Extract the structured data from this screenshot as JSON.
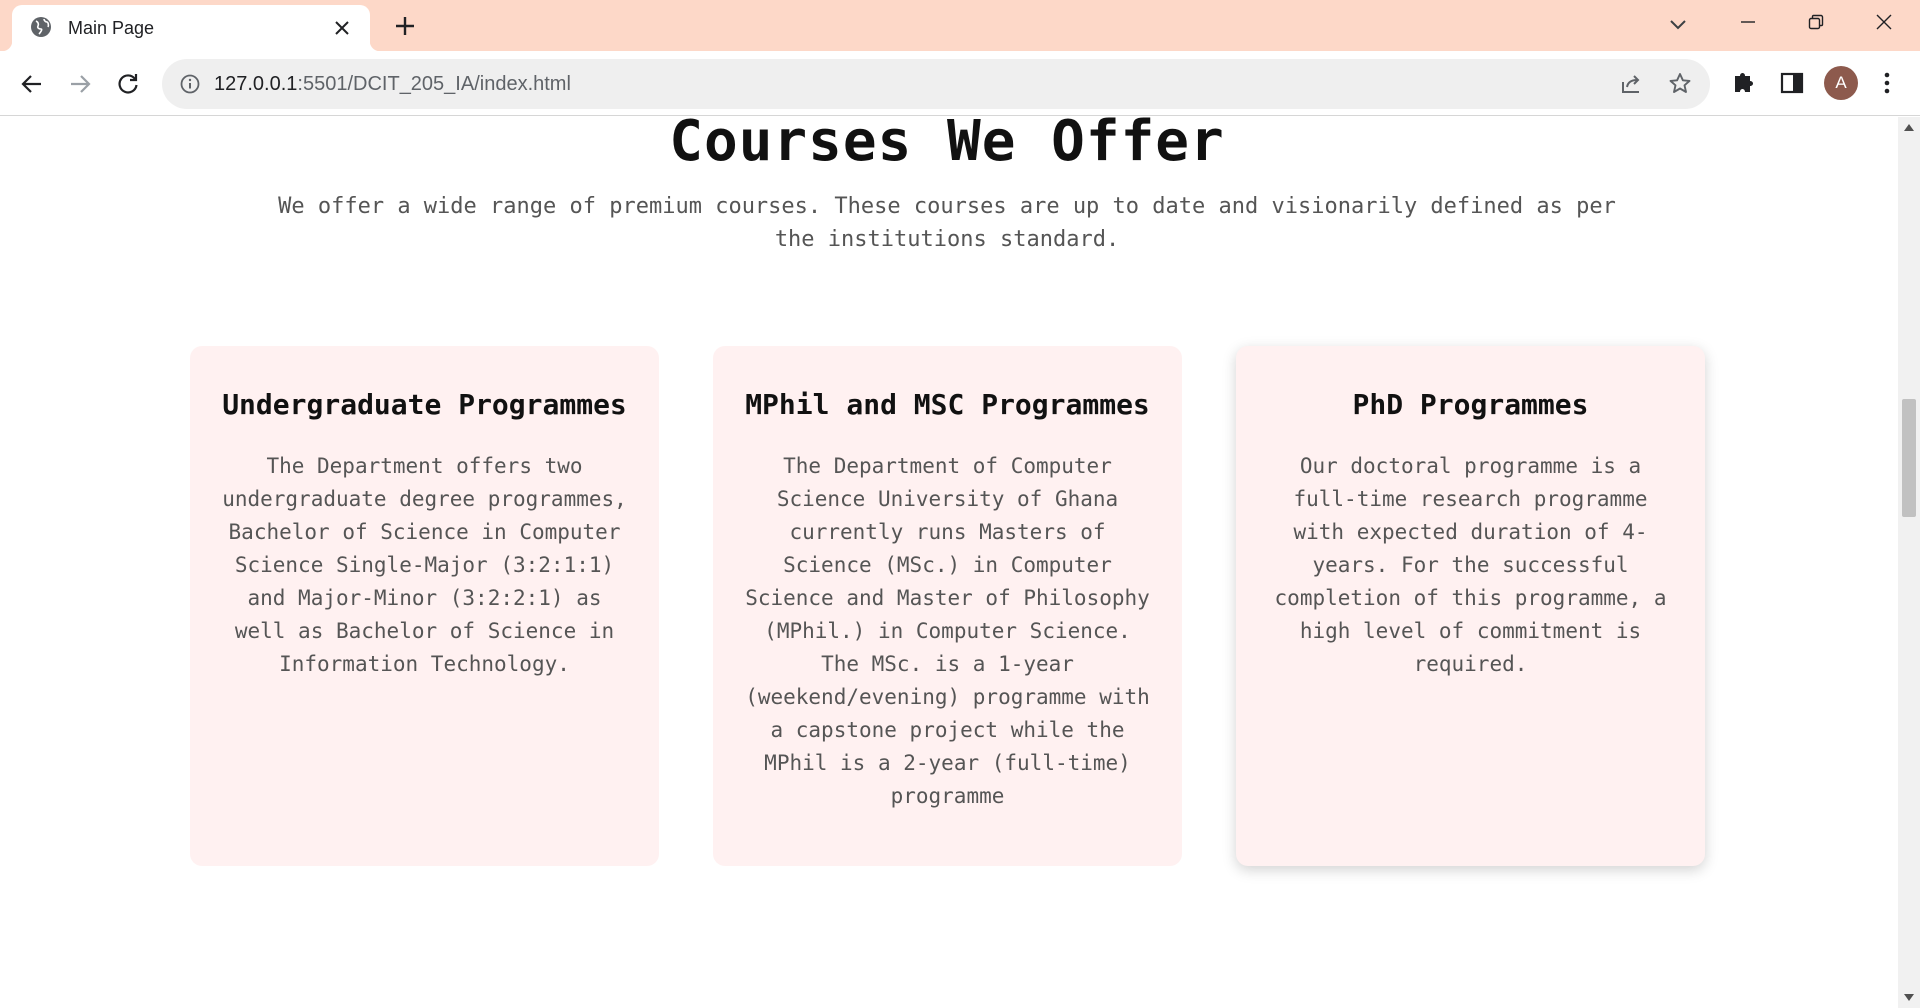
{
  "browser": {
    "tab": {
      "title": "Main Page"
    },
    "url": {
      "host": "127.0.0.1",
      "path": ":5501/DCIT_205_IA/index.html"
    },
    "profile_initial": "A"
  },
  "page": {
    "heading": "Courses We Offer",
    "intro": "We offer a wide range of premium courses. These courses are up to date and visionarily defined as per the institutions standard.",
    "cards": [
      {
        "title": "Undergraduate Programmes",
        "text": "The Department offers two undergraduate degree programmes, Bachelor of Science in Computer Science Single-Major (3:2:1:1) and Major-Minor (3:2:2:1) as well as Bachelor of Science in Information Technology."
      },
      {
        "title": "MPhil and MSC Programmes",
        "text": "The Department of Computer Science University of Ghana currently runs Masters of Science (MSc.) in Computer Science and Master of Philosophy (MPhil.) in Computer Science. The MSc. is a 1-year (weekend/evening) programme with a capstone project while the MPhil is a 2-year (full-time) programme"
      },
      {
        "title": "PhD Programmes",
        "text": "Our doctoral programme is a full-time research programme with expected duration of 4-years. For the successful completion of this programme, a high level of commitment is required."
      }
    ]
  },
  "colors": {
    "tabstrip": "#fdd8c8",
    "card_background": "#fff1f1",
    "heading_text": "#111111",
    "body_text": "#555555"
  }
}
